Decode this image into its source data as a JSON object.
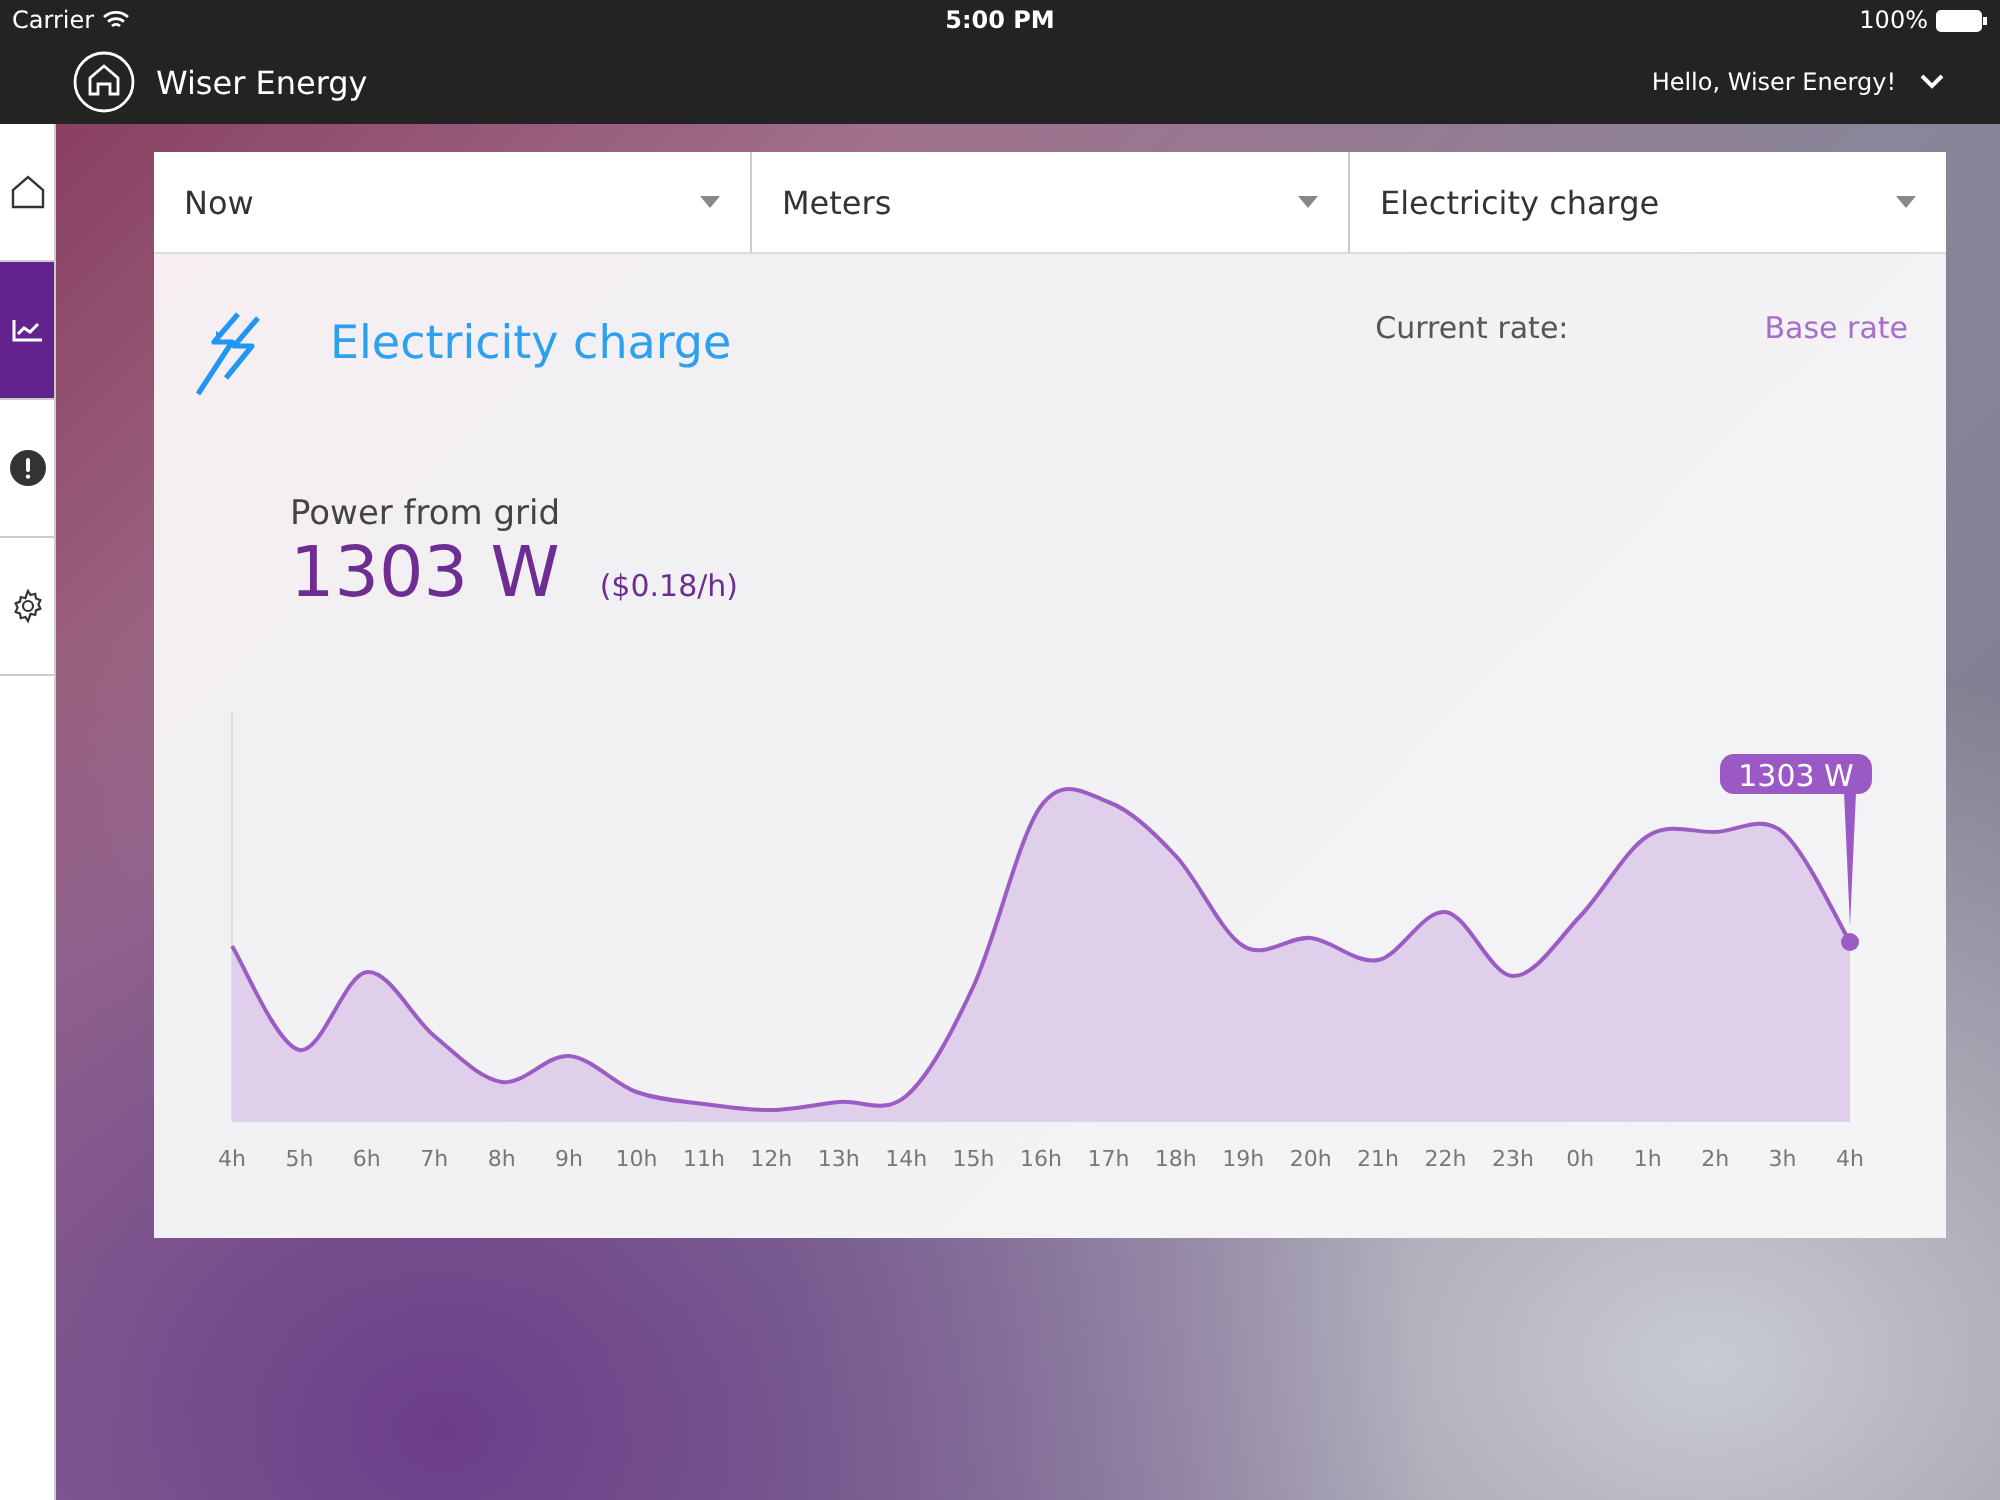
{
  "status_bar": {
    "carrier": "Carrier",
    "time": "5:00 PM",
    "battery": "100%"
  },
  "header": {
    "app_name": "Wiser Energy",
    "greeting": "Hello, Wiser Energy!"
  },
  "sidebar": {
    "items": [
      {
        "kind": "home",
        "selected": false
      },
      {
        "kind": "chart",
        "selected": true
      },
      {
        "kind": "alert",
        "selected": false
      },
      {
        "kind": "settings",
        "selected": false
      }
    ]
  },
  "filters": [
    {
      "value": "Now"
    },
    {
      "value": "Meters"
    },
    {
      "value": "Electricity charge"
    }
  ],
  "panel": {
    "title": "Electricity charge",
    "rate_label": "Current rate:",
    "rate_value": "Base rate",
    "metric_label": "Power from grid",
    "metric_value": "1303 W",
    "metric_cost": "($0.18/h)"
  },
  "chart": {
    "marker_label": "1303 W",
    "x_labels": [
      "4h",
      "5h",
      "6h",
      "7h",
      "8h",
      "9h",
      "10h",
      "11h",
      "12h",
      "13h",
      "14h",
      "15h",
      "16h",
      "17h",
      "18h",
      "19h",
      "20h",
      "21h",
      "22h",
      "23h",
      "0h",
      "1h",
      "2h",
      "3h",
      "4h"
    ]
  }
}
